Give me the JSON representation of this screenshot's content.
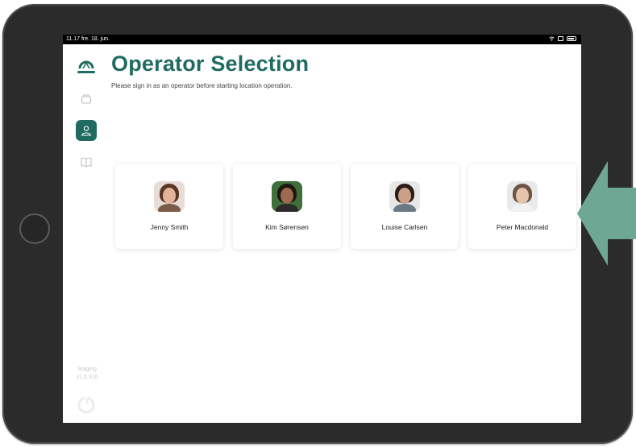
{
  "status_bar": {
    "time_date": "11.17  fre. 18. jun."
  },
  "header": {
    "title": "Operator Selection",
    "subtitle": "Please sign in as an operator before starting location operation."
  },
  "sidebar": {
    "nav_items": [
      {
        "icon": "box-icon",
        "active": false
      },
      {
        "icon": "user-icon",
        "active": true
      },
      {
        "icon": "book-icon",
        "active": false
      }
    ],
    "environment": "Staging",
    "version": "v1.0.310"
  },
  "operators": [
    {
      "name": "Jenny Smith",
      "skin": "#e2b59a",
      "hair": "#5a3424",
      "shirt": "#7a5c48",
      "bg": "#e8ddd6"
    },
    {
      "name": "Kim Sørensen",
      "skin": "#9c6a4c",
      "hair": "#1e1712",
      "shirt": "#2d2a28",
      "bg": "#3f6f3a"
    },
    {
      "name": "Louise Carlsen",
      "skin": "#caa089",
      "hair": "#2a1d17",
      "shirt": "#6b7a84",
      "bg": "#e7e7e7"
    },
    {
      "name": "Peter Macdonald",
      "skin": "#e6c3ab",
      "hair": "#6e5444",
      "shirt": "#f2f2f2",
      "bg": "#e9e9e9"
    }
  ],
  "colors": {
    "accent": "#1f6b62",
    "arrow": "#6fa795"
  }
}
